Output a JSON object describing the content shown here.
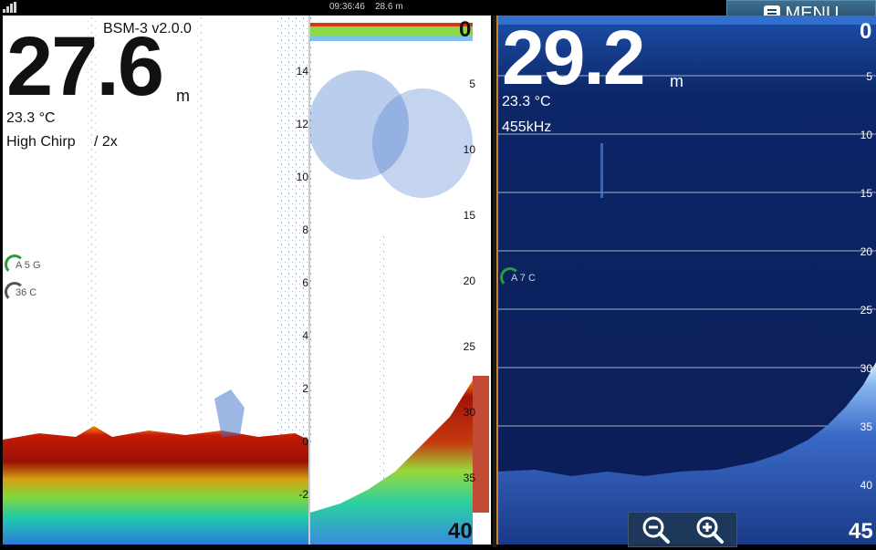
{
  "status": {
    "time": "09:36:46",
    "depth": "28.6 m"
  },
  "menu": {
    "label": "MENU",
    "icon": "menu-list-icon"
  },
  "left": {
    "title": "BSM-3 v2.0.0",
    "depth_value": "27.6",
    "depth_unit": "m",
    "temperature": "23.3 °C",
    "mode": "High Chirp",
    "zoom": "/ 2x",
    "gauge1": "A 5   G",
    "gauge2": "36    C",
    "range_top": "0",
    "range_bottom": "40",
    "inner_scale": [
      "14",
      "12",
      "10",
      "8",
      "6",
      "4",
      "2",
      "0",
      "-2"
    ],
    "depth_scale": [
      "5",
      "10",
      "15",
      "20",
      "25",
      "30",
      "35"
    ]
  },
  "right": {
    "depth_value": "29.2",
    "depth_unit": "m",
    "temperature": "23.3 °C",
    "frequency": "455kHz",
    "gauge": "A 7   C",
    "range_top": "0",
    "range_bottom": "45",
    "depth_scale": [
      "5",
      "10",
      "15",
      "20",
      "25",
      "30",
      "35",
      "40"
    ]
  },
  "zoom": {
    "zoom_out_icon": "zoom-out-icon",
    "zoom_in_icon": "zoom-in-icon"
  },
  "colors": {
    "menu_bg": "#2c5a7a",
    "right_bg": "#0c1f5c",
    "accent_orange": "#c9852a"
  }
}
